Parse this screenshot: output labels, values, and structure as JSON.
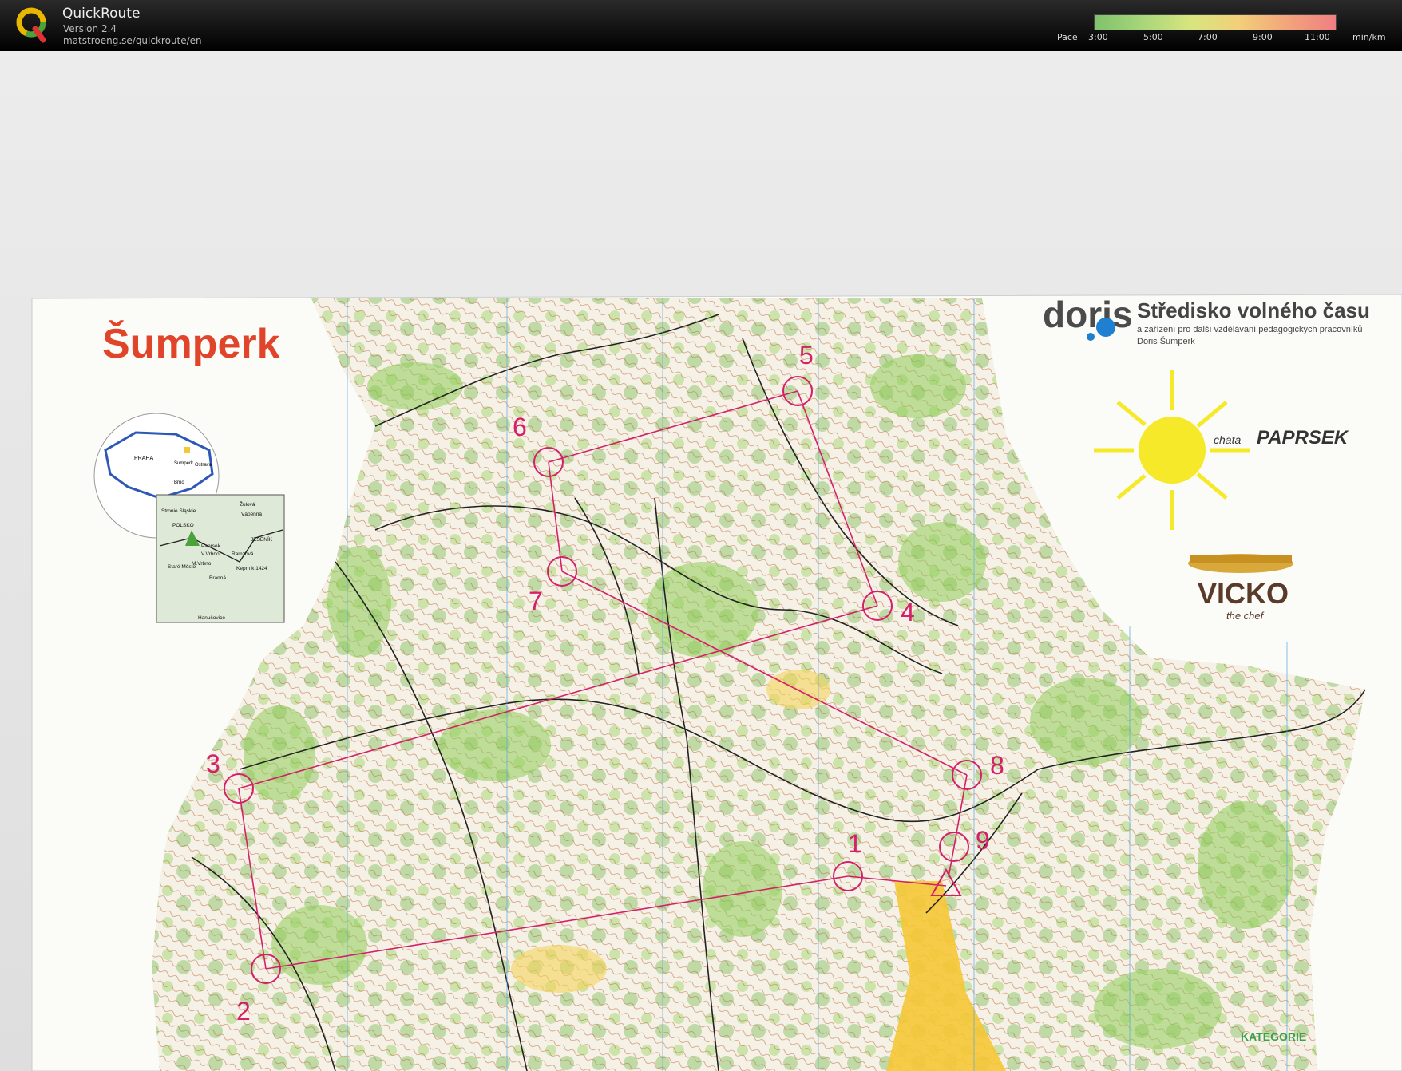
{
  "app": {
    "title": "QuickRoute",
    "version": "Version 2.4",
    "url": "matstroeng.se/quickroute/en",
    "logo_letter": "Q"
  },
  "pace_legend": {
    "label": "Pace",
    "ticks": [
      "3:00",
      "5:00",
      "7:00",
      "9:00",
      "11:00"
    ],
    "unit": "min/km"
  },
  "map": {
    "title": "Šumperk",
    "sponsor_doris": {
      "logo_text": "doris",
      "heading": "Středisko volného času",
      "line1": "a zařízení pro další vzdělávání pedagogických pracovníků",
      "line2": "Doris Šumperk"
    },
    "chata": {
      "small": "chata",
      "big": "PAPRSEK"
    },
    "vicko": {
      "brand": "VICKO",
      "tag": "the chef"
    },
    "category": "KATEGORIE",
    "inset": {
      "praha": "PRAHA",
      "brno": "Brno",
      "sumperk": "Šumperk",
      "ostrava": "Ostrava",
      "zulova": "Žulová",
      "stronie": "Stronie Śląskie",
      "polsko": "POLSKO",
      "vapenna": "Vápenná",
      "paprsek": "Paprsek",
      "vvrbno": "V.Vrbno",
      "jesenik": "JESENÍK",
      "mvrbno": "M.Vrbno",
      "ramzova": "Ramzová",
      "stara_mesto": "Staré Město",
      "keprnik": "Keprník 1424",
      "branna": "Branná",
      "hanusovice": "Hanušovice"
    },
    "controls": [
      "1",
      "2",
      "3",
      "4",
      "5",
      "6",
      "7",
      "8",
      "9"
    ],
    "colors": {
      "course": "#d4206a",
      "green": "#8fcc5a",
      "contour": "#b86b3c",
      "yellow": "#f5c735"
    }
  }
}
